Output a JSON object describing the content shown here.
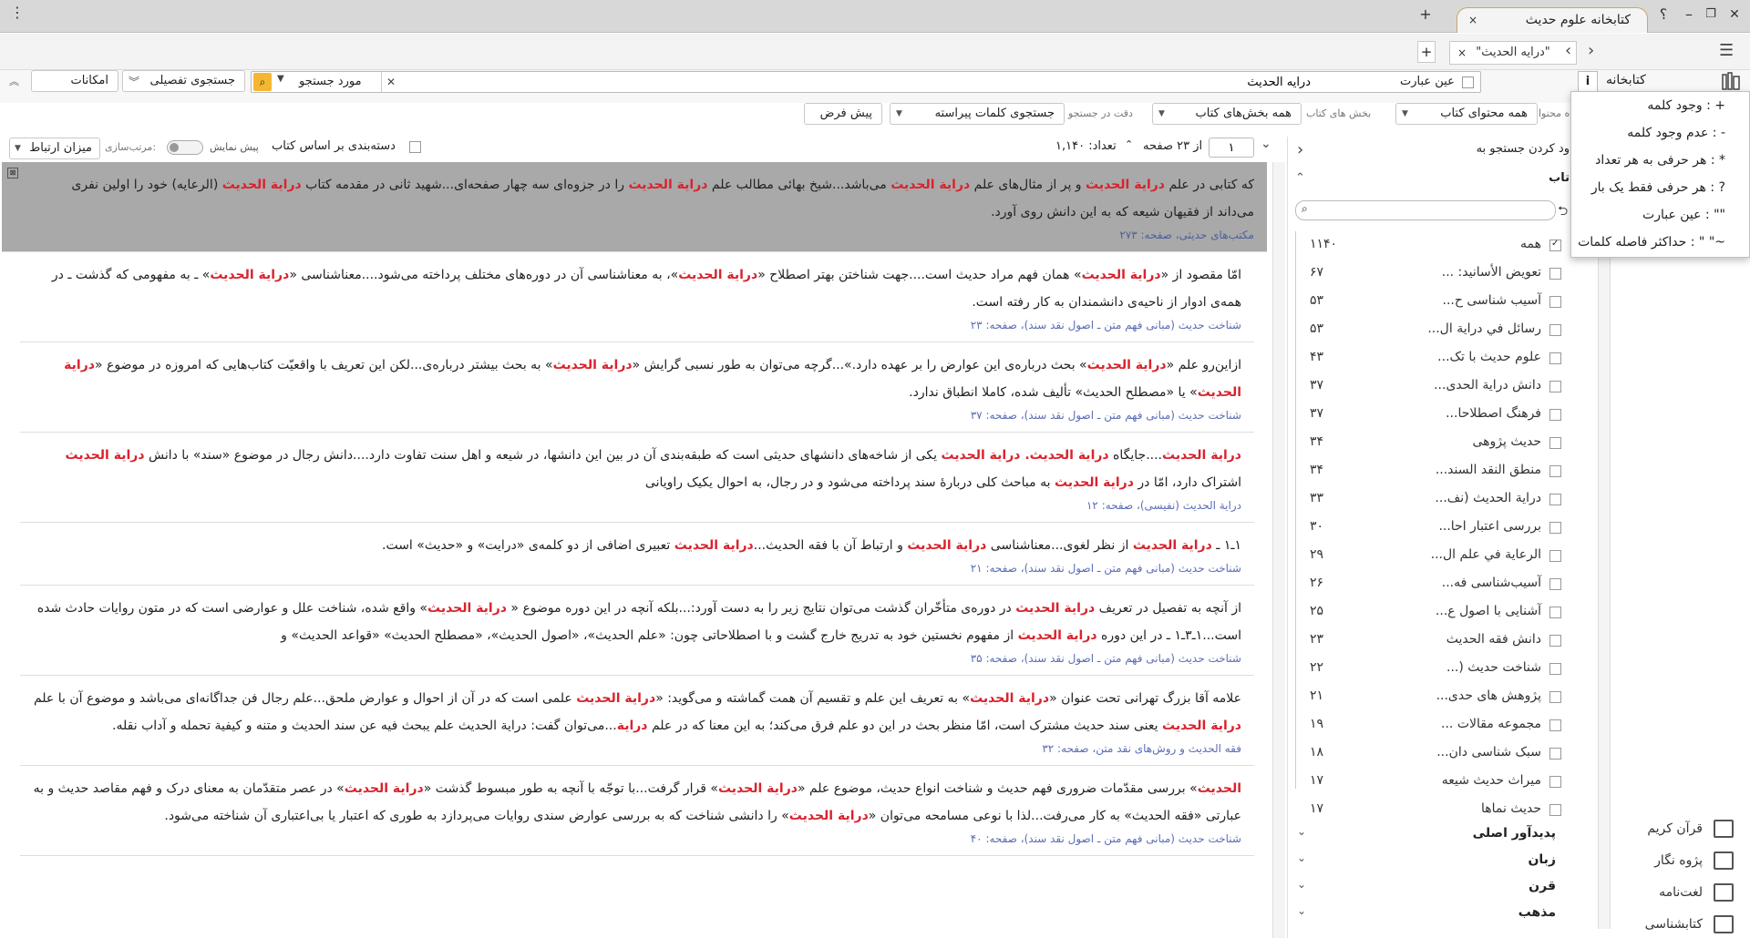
{
  "app": {
    "title": "کتابخانه علوم حدیث",
    "window_controls": {
      "help": "؟",
      "minimize": "–",
      "restore": "❐",
      "close": "✕"
    }
  },
  "tabs": {
    "doc_tab": "\"درایه الحدیث\"",
    "close": "×",
    "new": "+"
  },
  "search": {
    "query": "درایه الحدیث",
    "exact_label": "عین عبارت",
    "scope_label": "مورد جستجو",
    "detailed_label": "جستجوی تفصیلی",
    "features_label": "امکانات",
    "library_label": "کتابخانه",
    "content_label": "همه محتوای کتاب",
    "content_prefix": "ده محتوا",
    "sections_prefix": "بخش های کتاب",
    "sections_label": "همه بخش‌های کتاب",
    "precision_prefix": "دقت در جستجو",
    "precision_label": "جستجوی کلمات پیراسته",
    "default_label": "پیش فرض"
  },
  "results_bar": {
    "page_value": "۱",
    "of_pages": "از ۲۳ صفحه",
    "count": "تعداد: ۱,۱۴۰",
    "group_label": "دسته‌بندی بر اساس کتاب",
    "preview_label": "پیش نمایش",
    "sort_label": "مرتب‌سازی:",
    "relevance_label": "میزان ارتباط"
  },
  "menu": {
    "items": [
      "وجود کلمه : +",
      "عدم وجود کلمه : -",
      "هر حرفی به هر تعداد : *",
      "هر حرفی فقط یک بار : ?",
      "عین عبارت : \"\"",
      "حداکثر فاصله کلمات : \" \"~"
    ]
  },
  "facets": {
    "header_label": "ود کردن جستجو به",
    "book_label": "تاب",
    "all_label": "همه",
    "all_count": "۱۱۴۰",
    "items": [
      {
        "label": "تعویض الأسانید: ...",
        "count": "۶۷"
      },
      {
        "label": "آسیب شناسی ح...",
        "count": "۵۳"
      },
      {
        "label": "رسائل في دراية ال...",
        "count": "۵۳"
      },
      {
        "label": "علوم حدیث با تک...",
        "count": "۴۳"
      },
      {
        "label": "دانش درایة الحدی...",
        "count": "۳۷"
      },
      {
        "label": "فرهنگ اصطلاحا...",
        "count": "۳۷"
      },
      {
        "label": "حدیث پژوهی",
        "count": "۳۴"
      },
      {
        "label": "منطق النقد السند...",
        "count": "۳۴"
      },
      {
        "label": "درایة الحدیث (نف...",
        "count": "۳۳"
      },
      {
        "label": "بررسی اعتبار احا...",
        "count": "۳۰"
      },
      {
        "label": "الرعاية في علم ال...",
        "count": "۲۹"
      },
      {
        "label": "آسیب‌شناسی فه...",
        "count": "۲۶"
      },
      {
        "label": "آشنایی با اصول ع...",
        "count": "۲۵"
      },
      {
        "label": "دانش فقه الحدیث",
        "count": "۲۳"
      },
      {
        "label": "شناخت حدیث (...",
        "count": "۲۲"
      },
      {
        "label": "پژوهش های حدی...",
        "count": "۲۱"
      },
      {
        "label": "مجموعه مقالات ...",
        "count": "۱۹"
      },
      {
        "label": "سبک شناسی دان...",
        "count": "۱۸"
      },
      {
        "label": "میراث حدیث شیعه",
        "count": "۱۷"
      },
      {
        "label": "حدیث نماها",
        "count": "۱۷"
      }
    ],
    "sections": [
      "پدیدآور اصلی",
      "زبان",
      "قرن",
      "مذهب"
    ]
  },
  "sidebar": {
    "items": [
      "قرآن کریم",
      "پژوه نگار",
      "لغت‌نامه",
      "کتابشناسی"
    ]
  },
  "results": [
    {
      "t1": "که کتابی در علم ",
      "h1": "درایة الحدیث",
      "t2": " و پر از مثال‌های علم ",
      "h2": "درایة الحدیث",
      "t3": " می‌باشد...شیخ بهائی مطالب علم ",
      "h3": "درایة الحدیث",
      "t4": " را در جزوه‌ای سه چهار صفحه‌ای...شهید ثانی در مقدمه کتاب ",
      "h4": "درایة الحدیث",
      "t5": " (الرعایه) خود را اولین نفری می‌داند از فقیهان شیعه که به این دانش روی آورد.",
      "src": "مکتب‌های حدیثی، صفحه: ۲۷۳"
    },
    {
      "t1": "امّا مقصود از «",
      "h1": "درایة الحدیث",
      "t2": "» همان فهم مراد حدیث است....جهت شناختن بهتر اصطلاح «",
      "h2": "درایة الحدیث",
      "t3": "»، به معناشناسی آن در دوره‌های مختلف پرداخته می‌شود....معناشناسی «",
      "h3": "درایة الحدیث",
      "t4": "» ـ به مفهومی که گذشت ـ در همه‌ی ادوار از ناحیه‌ی دانشمندان به کار رفته است.",
      "h4": "",
      "t5": "",
      "src": "شناخت حدیث (مبانی فهم متن ـ اصول نقد سند)، صفحه: ۲۳"
    },
    {
      "t1": "ازاین‌رو علم «",
      "h1": "درایة الحدیث",
      "t2": "» بحث درباره‌ی این عوارض را بر عهده دارد.»...گرچه می‌توان به طور نسبی گرایش «",
      "h2": "درایة الحدیث",
      "t3": "» به بحث بیشتر درباره‌ی...لکن این تعریف با واقعیّت کتاب‌هایی که امروزه در موضوع «",
      "h3": "درایة الحدیث",
      "t4": "» یا «مصطلح الحدیث» تألیف شده، کاملا انطباق ندارد.",
      "h4": "",
      "t5": "",
      "src": "شناخت حدیث (مبانی فهم متن ـ اصول نقد سند)، صفحه: ۳۷"
    },
    {
      "t1": "",
      "h1": "درایة الحدیث",
      "t2": "....جایگاه ",
      "h2": "درایة الحدیث. درایة الحدیث",
      "t3": " یکی از شاخه‌های دانشهای حدیثی است که طبقه‌بندی آن در بین این دانشها، در شیعه و اهل سنت تفاوت دارد....دانش رجال در موضوع «سند» با دانش ",
      "h3": "درایة الحدیث",
      "t4": " اشتراک دارد، امّا در ",
      "h4": "درایة الحدیث",
      "t5": " به مباحث کلی دربارۀ سند پرداخته می‌شود و در رجال، به احوال یکیک راویانی",
      "src": "درایة الحدیث (نفیسی)، صفحه: ۱۲"
    },
    {
      "t1": "۱ـ۱ ـ ",
      "h1": "درایة الحدیث",
      "t2": " از نظر لغوی...معناشناسی ",
      "h2": "درایة الحدیث",
      "t3": " و ارتباط آن با فقه الحدیث...",
      "h3": "درایة الحدیث",
      "t4": " تعبیری اضافی از دو کلمه‌ی «درایت» و «حدیث» است.",
      "h4": "",
      "t5": "",
      "src": "شناخت حدیث (مبانی فهم متن ـ اصول نقد سند)، صفحه: ۲۱"
    },
    {
      "t1": "از آنچه به تفصیل در تعریف ",
      "h1": "درایة الحدیث",
      "t2": " در دوره‌ی متأخّران گذشت می‌توان نتایج زیر را به دست آورد:...بلکه آنچه در این دوره موضوع « ",
      "h2": "درایة الحدیث",
      "t3": "» واقع شده، شناخت علل و عوارضی است که در متون روایات حادث شده است...۱ـ۳ـ۱ ـ در این دوره ",
      "h3": "درایة الحدیث",
      "t4": " از مفهوم نخستین خود به تدریج خارج گشت و با اصطلاحاتی چون: «علم الحدیث»، «اصول الحدیث»، «مصطلح الحدیث» «قواعد الحدیث» و",
      "h4": "",
      "t5": "",
      "src": "شناخت حدیث (مبانی فهم متن ـ اصول نقد سند)، صفحه: ۳۵"
    },
    {
      "t1": "علامه آقا بزرگ تهرانی تحت عنوان «",
      "h1": "درایة الحدیث",
      "t2": "» به تعریف این علم و تقسیم آن همت گماشته و می‌گوید: «",
      "h2": "درایة الحدیث",
      "t3": " علمی است که در آن از احوال و عوارض ملحق...علم رجال فن جداگانه‌ای می‌باشد و موضوع آن با علم ",
      "h3": "درایة الحدیث",
      "t4": " یعنی سند حدیث مشترک است، امّا منظر بحث در این دو علم فرق می‌کند؛ به این معنا که در علم ",
      "h4": "درایة",
      "t5": "...می‌توان گفت: درایة الحدیث علم يبحث فيه عن سند الحديث و متنه و كيفية تحمله و آداب نقله.",
      "src": "فقه الحدیث و روش‌های نقد متن، صفحه: ۳۲"
    },
    {
      "t1": "",
      "h1": "الحدیث",
      "t2": "» بررسی مقدّمات ضروری فهم حدیث و شناخت انواع حدیث، موضوع علم «",
      "h2": "درایة الحدیث",
      "t3": "» قرار گرفت...با توجّه با آنچه به طور مبسوط گذشت «",
      "h3": "درایة الحدیث",
      "t4": "» در عصر متقدّمان به معنای درک و فهم مقاصد حدیث و به عبارتی «فقه الحدیث» به کار می‌رفت...لذا با نوعی مسامحه می‌توان «",
      "h4": "درایة الحدیث",
      "t5": "» را دانشی شناخت که به بررسی عوارض سندی روایات می‌پردازد به طوری که اعتبار یا بی‌اعتباری آن شناخته می‌شود.",
      "src": "شناخت حدیث (مبانی فهم متن ـ اصول نقد سند)، صفحه: ۴۰"
    }
  ]
}
